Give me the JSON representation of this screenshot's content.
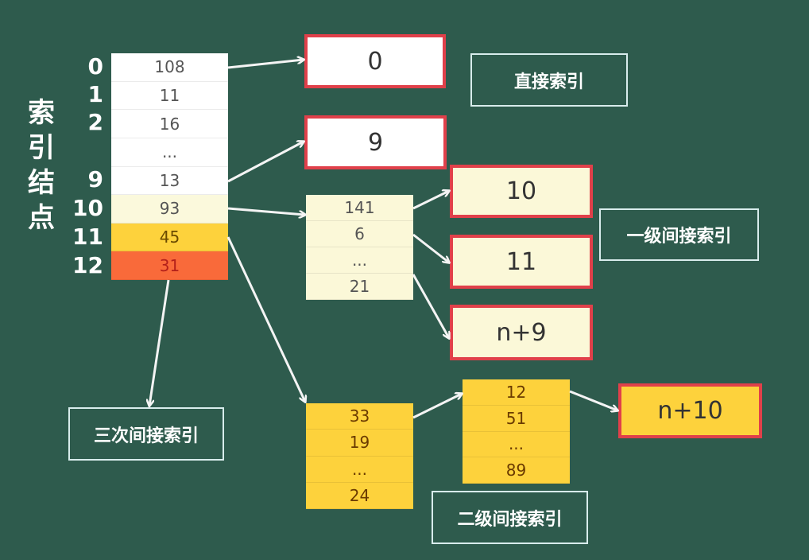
{
  "title_vertical": [
    "索",
    "引",
    "结",
    "点"
  ],
  "index_node": {
    "row_labels": [
      "0",
      "1",
      "2",
      "",
      "9",
      "10",
      "11",
      "12"
    ],
    "cells": [
      {
        "value": "108",
        "color": "#ffffff"
      },
      {
        "value": "11",
        "color": "#ffffff"
      },
      {
        "value": "16",
        "color": "#ffffff"
      },
      {
        "value": "...",
        "color": "#ffffff"
      },
      {
        "value": "13",
        "color": "#ffffff"
      },
      {
        "value": "93",
        "color": "#fbf9dc"
      },
      {
        "value": "45",
        "color": "#fdd23c"
      },
      {
        "value": "31",
        "color": "#f96a3a"
      }
    ]
  },
  "direct_blocks": [
    "0",
    "9"
  ],
  "level1_index_block": [
    "141",
    "6",
    "...",
    "21"
  ],
  "level1_data_blocks": [
    "10",
    "11",
    "n+9"
  ],
  "level2_index_block_a": [
    "33",
    "19",
    "...",
    "24"
  ],
  "level2_index_block_b": [
    "12",
    "51",
    "...",
    "89"
  ],
  "level2_data_block": "n+10",
  "labels": {
    "direct": "直接索引",
    "level1": "一级间接索引",
    "level2": "二级间接索引",
    "level3": "三次间接索引"
  },
  "colors": {
    "background": "#2e5b4d",
    "border_red": "#e0404a",
    "pale_yellow": "#fbf8d8",
    "yellow": "#fdd23c",
    "orange": "#f96a3a"
  }
}
